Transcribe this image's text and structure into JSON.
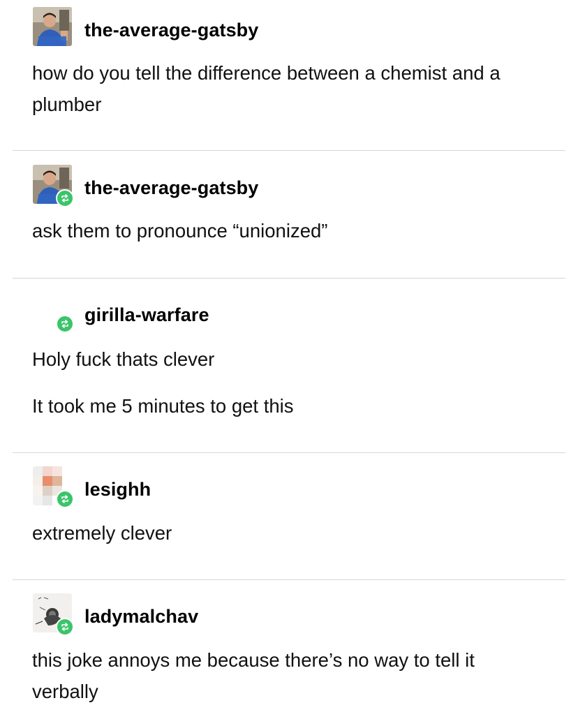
{
  "posts": [
    {
      "username": "the-average-gatsby",
      "avatar": "photo-man-avatar",
      "reblog": false,
      "paragraphs": [
        "how do you tell the difference between a chemist and a plumber"
      ]
    },
    {
      "username": "the-average-gatsby",
      "avatar": "photo-man-avatar",
      "reblog": true,
      "paragraphs": [
        "ask them to pronounce “unionized”"
      ]
    },
    {
      "username": "girilla-warfare",
      "avatar": "none",
      "reblog": true,
      "paragraphs": [
        "Holy fuck thats clever",
        "It took me 5 minutes to get this"
      ]
    },
    {
      "username": "lesighh",
      "avatar": "pixelated-avatar",
      "reblog": true,
      "paragraphs": [
        "extremely clever"
      ]
    },
    {
      "username": "ladymalchav",
      "avatar": "sketch-drawing-avatar",
      "reblog": true,
      "paragraphs": [
        "this joke annoys me because there’s no way to tell it verbally"
      ]
    }
  ],
  "colors": {
    "reblog_badge": "#3bc46b",
    "divider": "#d6d6d6",
    "text": "#111111"
  },
  "icons": {
    "reblog": "reblog-arrows-icon"
  }
}
